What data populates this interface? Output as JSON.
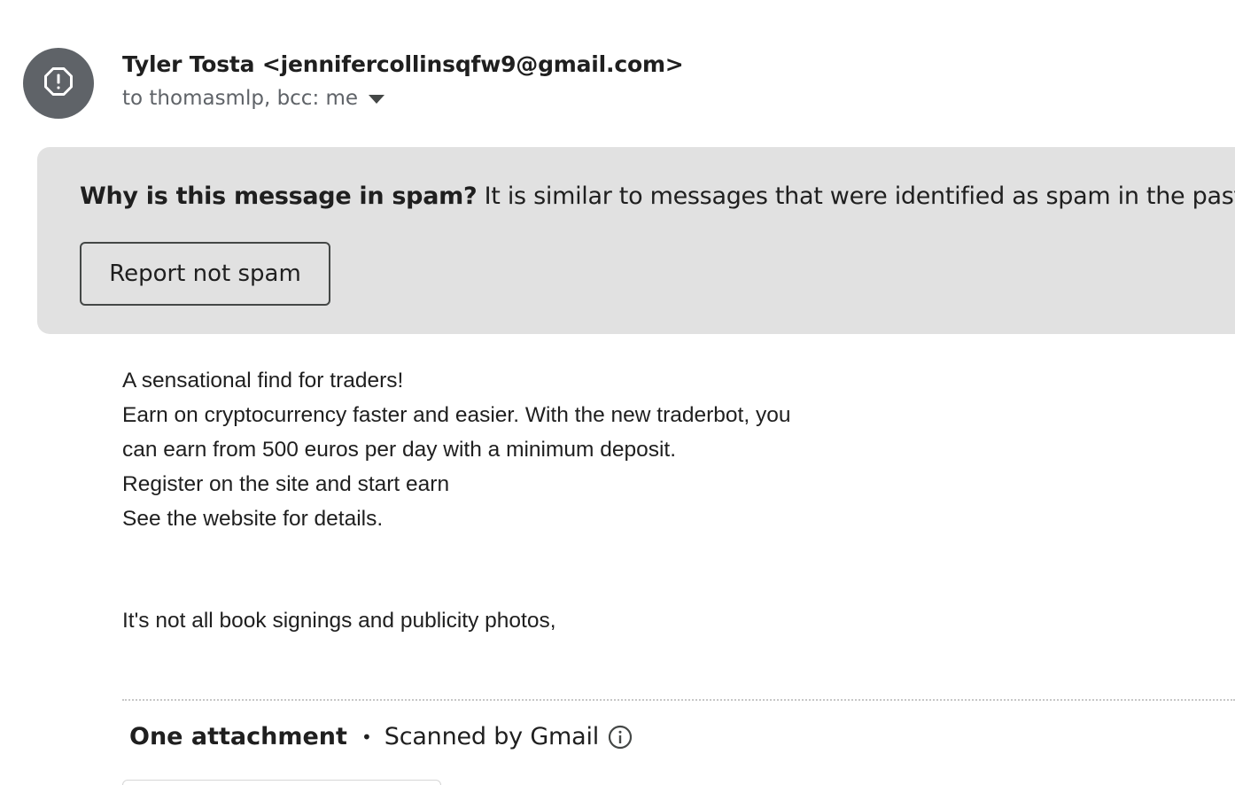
{
  "header": {
    "sender": "Tyler Tosta <jennifercollinsqfw9@gmail.com>",
    "recipients": "to thomasmlp, bcc: me",
    "avatar_icon": "warning-octagon-icon",
    "details_icon": "caret-down-icon"
  },
  "spam_banner": {
    "question": "Why is this message in spam?",
    "explanation": "It is similar to messages that were identified as spam in the past.",
    "report_button": "Report not spam"
  },
  "message": {
    "lines": [
      "A sensational find for traders!",
      "Earn on cryptocurrency faster and easier. With the new traderbot, you",
      "can earn from 500 euros per day with a minimum deposit.",
      "Register on the site and start earn",
      "See the website for details."
    ],
    "closing": "It's not all book signings and publicity photos,"
  },
  "attachments": {
    "title": "One attachment",
    "separator": "•",
    "scanned_label": "Scanned by Gmail",
    "info_icon": "info-icon"
  },
  "colors": {
    "banner_bg": "#e1e1e1",
    "avatar_bg": "#5f6368",
    "secondary_text": "#5f6368"
  }
}
